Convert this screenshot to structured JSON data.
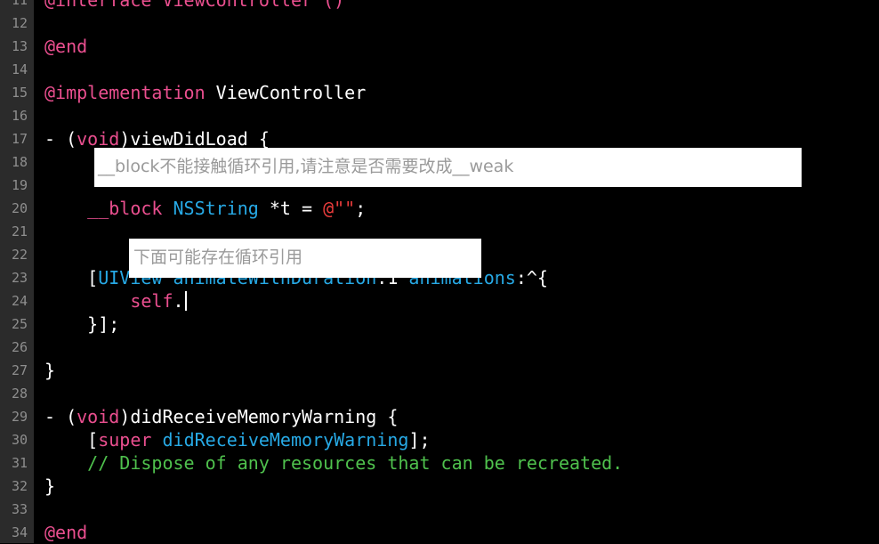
{
  "editor": {
    "lines": [
      {
        "number": "11",
        "tokens": [
          {
            "text": "@interface ViewController ()",
            "cls": "tk-keyword"
          }
        ]
      },
      {
        "number": "12",
        "tokens": []
      },
      {
        "number": "13",
        "tokens": [
          {
            "text": "@end",
            "cls": "tk-keyword"
          }
        ]
      },
      {
        "number": "14",
        "tokens": []
      },
      {
        "number": "15",
        "tokens": [
          {
            "text": "@implementation",
            "cls": "tk-keyword"
          },
          {
            "text": " ViewController",
            "cls": "tk-plain"
          }
        ]
      },
      {
        "number": "16",
        "tokens": []
      },
      {
        "number": "17",
        "tokens": [
          {
            "text": "- (",
            "cls": "tk-plain"
          },
          {
            "text": "void",
            "cls": "tk-keyword"
          },
          {
            "text": ")viewDidLoad {",
            "cls": "tk-plain"
          }
        ]
      },
      {
        "number": "18",
        "tokens": []
      },
      {
        "number": "19",
        "tokens": []
      },
      {
        "number": "20",
        "tokens": [
          {
            "text": "    ",
            "cls": "tk-plain"
          },
          {
            "text": "__block",
            "cls": "tk-keyword"
          },
          {
            "text": " ",
            "cls": "tk-plain"
          },
          {
            "text": "NSString",
            "cls": "tk-type"
          },
          {
            "text": " *t = ",
            "cls": "tk-plain"
          },
          {
            "text": "@\"\"",
            "cls": "tk-string"
          },
          {
            "text": ";",
            "cls": "tk-plain"
          }
        ]
      },
      {
        "number": "21",
        "tokens": []
      },
      {
        "number": "22",
        "tokens": []
      },
      {
        "number": "23",
        "tokens": [
          {
            "text": "    [",
            "cls": "tk-plain"
          },
          {
            "text": "UIView",
            "cls": "tk-type"
          },
          {
            "text": " ",
            "cls": "tk-plain"
          },
          {
            "text": "animateWithDuration",
            "cls": "tk-type"
          },
          {
            "text": ":1 ",
            "cls": "tk-plain"
          },
          {
            "text": "animations",
            "cls": "tk-type"
          },
          {
            "text": ":^{",
            "cls": "tk-plain"
          }
        ]
      },
      {
        "number": "24",
        "tokens": [
          {
            "text": "        ",
            "cls": "tk-plain"
          },
          {
            "text": "self",
            "cls": "tk-keyword"
          },
          {
            "text": ".",
            "cls": "tk-plain"
          }
        ],
        "caret": true
      },
      {
        "number": "25",
        "tokens": [
          {
            "text": "    }];",
            "cls": "tk-plain"
          }
        ]
      },
      {
        "number": "26",
        "tokens": []
      },
      {
        "number": "27",
        "tokens": [
          {
            "text": "}",
            "cls": "tk-plain"
          }
        ]
      },
      {
        "number": "28",
        "tokens": []
      },
      {
        "number": "29",
        "tokens": [
          {
            "text": "- (",
            "cls": "tk-plain"
          },
          {
            "text": "void",
            "cls": "tk-keyword"
          },
          {
            "text": ")didReceiveMemoryWarning {",
            "cls": "tk-plain"
          }
        ]
      },
      {
        "number": "30",
        "tokens": [
          {
            "text": "    [",
            "cls": "tk-plain"
          },
          {
            "text": "super",
            "cls": "tk-keyword"
          },
          {
            "text": " ",
            "cls": "tk-plain"
          },
          {
            "text": "didReceiveMemoryWarning",
            "cls": "tk-type"
          },
          {
            "text": "];",
            "cls": "tk-plain"
          }
        ]
      },
      {
        "number": "31",
        "tokens": [
          {
            "text": "    ",
            "cls": "tk-plain"
          },
          {
            "text": "// Dispose of any resources that can be recreated.",
            "cls": "tk-comment"
          }
        ]
      },
      {
        "number": "32",
        "tokens": [
          {
            "text": "}",
            "cls": "tk-plain"
          }
        ]
      },
      {
        "number": "33",
        "tokens": []
      },
      {
        "number": "34",
        "tokens": [
          {
            "text": "@end",
            "cls": "tk-keyword"
          }
        ]
      }
    ]
  },
  "annotations": {
    "block_warning": "__block不能接触循环引用,请注意是否需要改成__weak",
    "retain_cycle_warning": "下面可能存在循环引用"
  },
  "colors": {
    "background": "#000000",
    "gutter": "#2b2b2b",
    "line_number": "#8e8e8e",
    "keyword": "#ea4f8f",
    "type": "#27a9e5",
    "string": "#ea3c3c",
    "comment": "#4fc14d"
  }
}
